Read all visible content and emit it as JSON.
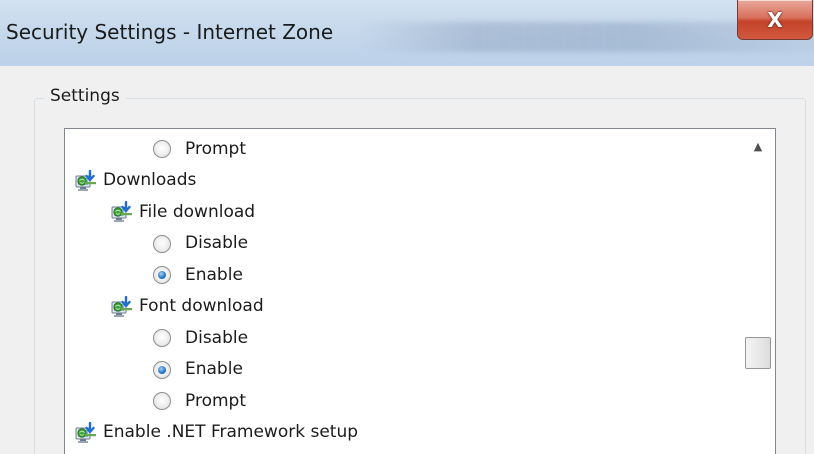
{
  "window": {
    "title": "Security Settings - Internet Zone",
    "close_glyph": "X"
  },
  "group": {
    "label": "Settings"
  },
  "settings_list": {
    "items": [
      {
        "kind": "option",
        "label": "Prompt",
        "checked": false,
        "level": 2
      },
      {
        "kind": "category",
        "label": "Downloads",
        "icon": "internet-download-settings-icon",
        "level": 0
      },
      {
        "kind": "category",
        "label": "File download",
        "icon": "internet-download-settings-icon",
        "level": 1
      },
      {
        "kind": "option",
        "label": "Disable",
        "checked": false,
        "level": 2
      },
      {
        "kind": "option",
        "label": "Enable",
        "checked": true,
        "level": 2
      },
      {
        "kind": "category",
        "label": "Font download",
        "icon": "internet-download-settings-icon",
        "level": 1
      },
      {
        "kind": "option",
        "label": "Disable",
        "checked": false,
        "level": 2
      },
      {
        "kind": "option",
        "label": "Enable",
        "checked": true,
        "level": 2
      },
      {
        "kind": "option",
        "label": "Prompt",
        "checked": false,
        "level": 2
      },
      {
        "kind": "category",
        "label": "Enable .NET Framework setup",
        "icon": "internet-download-settings-icon",
        "level": 0
      }
    ]
  },
  "scrollbar": {
    "up_icon": "scroll-up-arrow-icon",
    "position": 0.62
  },
  "colors": {
    "radio_selected": "#2a7ac8",
    "close_button": "#c3432a",
    "titlebar": "#c7d9ec"
  }
}
